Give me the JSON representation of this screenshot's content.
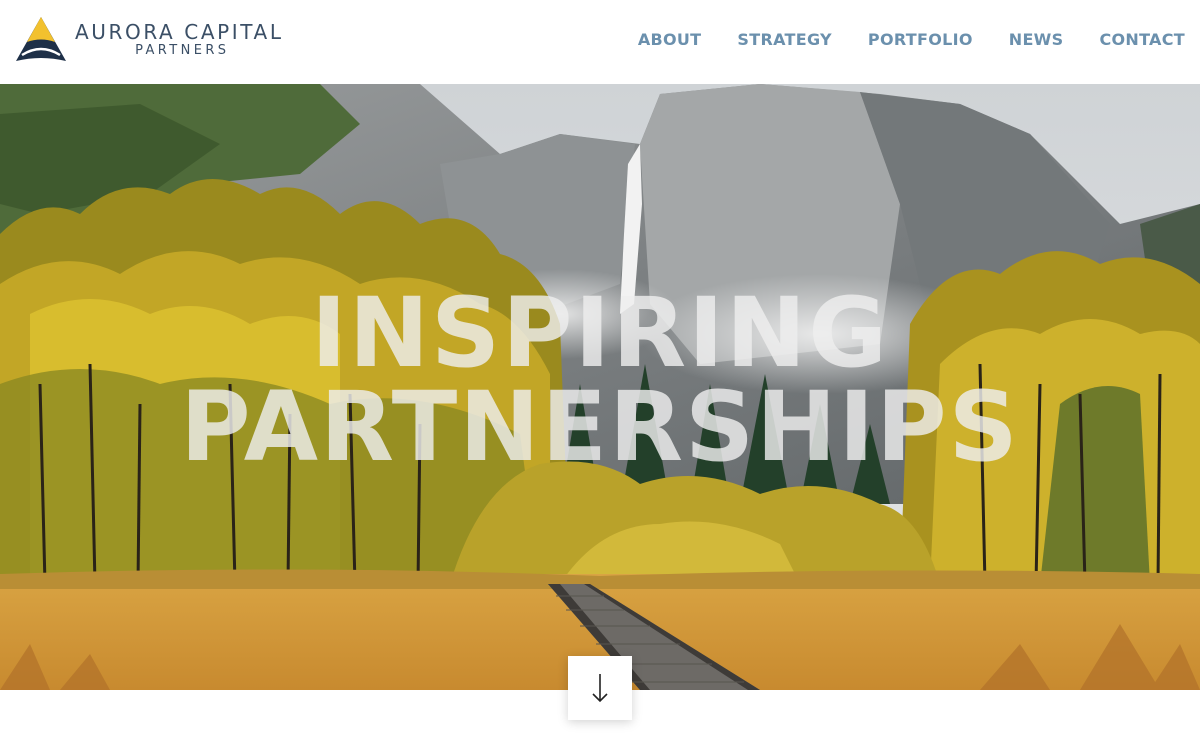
{
  "brand": {
    "name_line1": "AURORA CAPITAL",
    "name_line2": "PARTNERS",
    "logo_icon": "aurora-triangle-logo",
    "colors": {
      "navy": "#1e3048",
      "gold": "#f2c12e",
      "text": "#3b4f66"
    }
  },
  "nav": {
    "items": [
      {
        "label": "ABOUT"
      },
      {
        "label": "STRATEGY"
      },
      {
        "label": "PORTFOLIO"
      },
      {
        "label": "NEWS"
      },
      {
        "label": "CONTACT"
      }
    ],
    "color": "#6b90ad"
  },
  "hero": {
    "headline_line1": "INSPIRING",
    "headline_line2": "PARTNERSHIPS",
    "scene": "mountain-waterfall-forest-meadow-boardwalk"
  },
  "scroll_button": {
    "icon": "arrow-down-icon"
  }
}
